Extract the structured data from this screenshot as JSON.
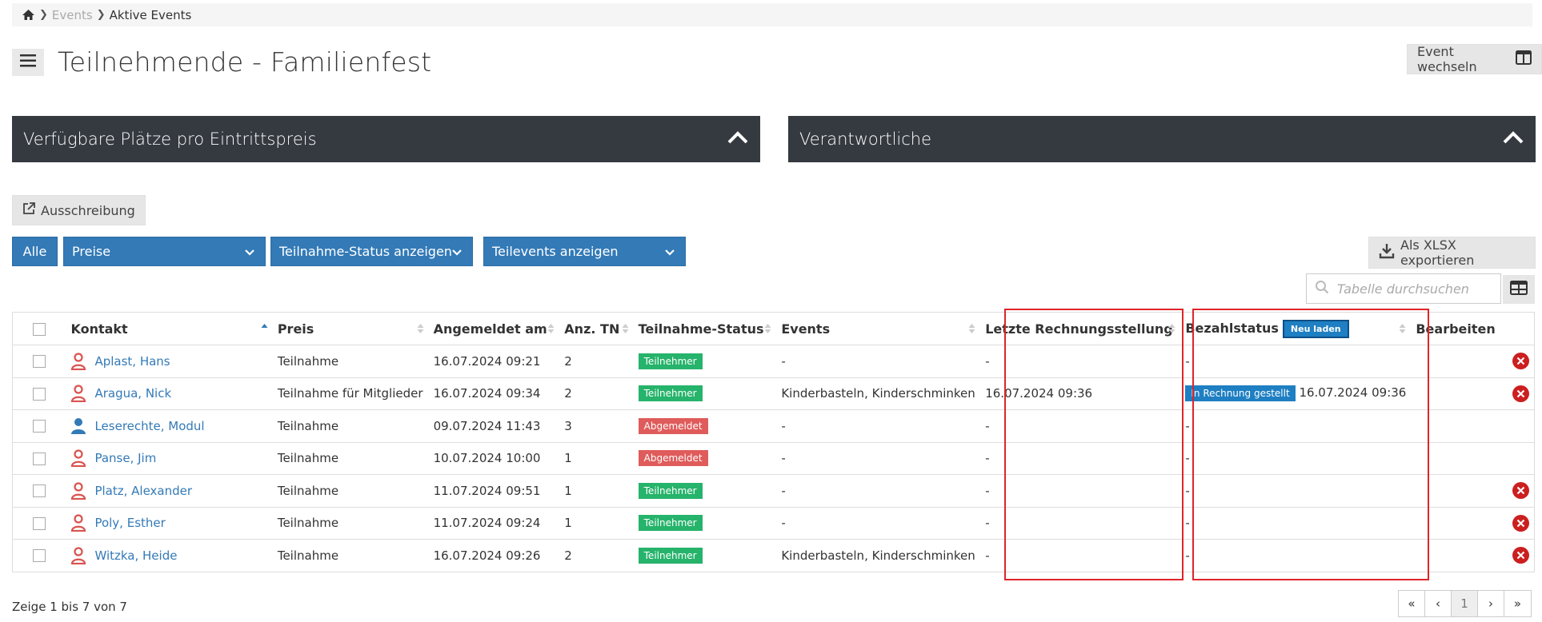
{
  "breadcrumb": {
    "level1": "Events",
    "level2": "Aktive Events"
  },
  "page_title": "Teilnehmende - Familienfest",
  "event_switch_label": "Event wechseln",
  "panels": {
    "left": "Verfügbare Plätze pro Eintrittspreis",
    "right": "Verantwortliche"
  },
  "ausschreibung_label": "Ausschreibung",
  "filters": {
    "all": "Alle",
    "prices": "Preise",
    "status": "Teilnahme-Status anzeigen",
    "subevents": "Teilevents anzeigen"
  },
  "export_label": "Als XLSX exportieren",
  "search_placeholder": "Tabelle durchsuchen",
  "table": {
    "headers": {
      "contact": "Kontakt",
      "price": "Preis",
      "registered": "Angemeldet am",
      "count": "Anz. TN",
      "status": "Teilnahme-Status",
      "events": "Events",
      "invoice": "Letzte Rechnungsstellung",
      "payment": "Bezahlstatus",
      "reload": "Neu laden",
      "edit": "Bearbeiten"
    },
    "rows": [
      {
        "name": "Aplast, Hans",
        "price": "Teilnahme",
        "registered": "16.07.2024 09:21",
        "count": "2",
        "status": "Teilnehmer",
        "events": "-",
        "invoice": "-",
        "payment_badge": "",
        "payment": "-"
      },
      {
        "name": "Aragua, Nick",
        "price": "Teilnahme für Mitglieder",
        "registered": "16.07.2024 09:34",
        "count": "2",
        "status": "Teilnehmer",
        "events": "Kinderbasteln, Kinderschminken",
        "invoice": "16.07.2024 09:36",
        "payment_badge": "In Rechnung gestellt",
        "payment": "16.07.2024 09:36"
      },
      {
        "name": "Leserechte, Modul",
        "price": "Teilnahme",
        "registered": "09.07.2024 11:43",
        "count": "3",
        "status": "Abgemeldet",
        "events": "-",
        "invoice": "-",
        "payment_badge": "",
        "payment": "-"
      },
      {
        "name": "Panse, Jim",
        "price": "Teilnahme",
        "registered": "10.07.2024 10:00",
        "count": "1",
        "status": "Abgemeldet",
        "events": "-",
        "invoice": "-",
        "payment_badge": "",
        "payment": "-"
      },
      {
        "name": "Platz, Alexander",
        "price": "Teilnahme",
        "registered": "11.07.2024 09:51",
        "count": "1",
        "status": "Teilnehmer",
        "events": "-",
        "invoice": "-",
        "payment_badge": "",
        "payment": "-"
      },
      {
        "name": "Poly, Esther",
        "price": "Teilnahme",
        "registered": "11.07.2024 09:24",
        "count": "1",
        "status": "Teilnehmer",
        "events": "-",
        "invoice": "-",
        "payment_badge": "",
        "payment": "-"
      },
      {
        "name": "Witzka, Heide",
        "price": "Teilnahme",
        "registered": "16.07.2024 09:26",
        "count": "2",
        "status": "Teilnehmer",
        "events": "Kinderbasteln, Kinderschminken",
        "invoice": "-",
        "payment_badge": "",
        "payment": "-"
      }
    ]
  },
  "footer_info": "Zeige 1 bis 7 von 7",
  "pagination": {
    "current": "1"
  },
  "colors": {
    "primary": "#337ab7",
    "panel_dark": "#343a40",
    "status_green": "#26b36b",
    "status_red": "#e05b5b",
    "highlight_red": "#e0242a"
  }
}
